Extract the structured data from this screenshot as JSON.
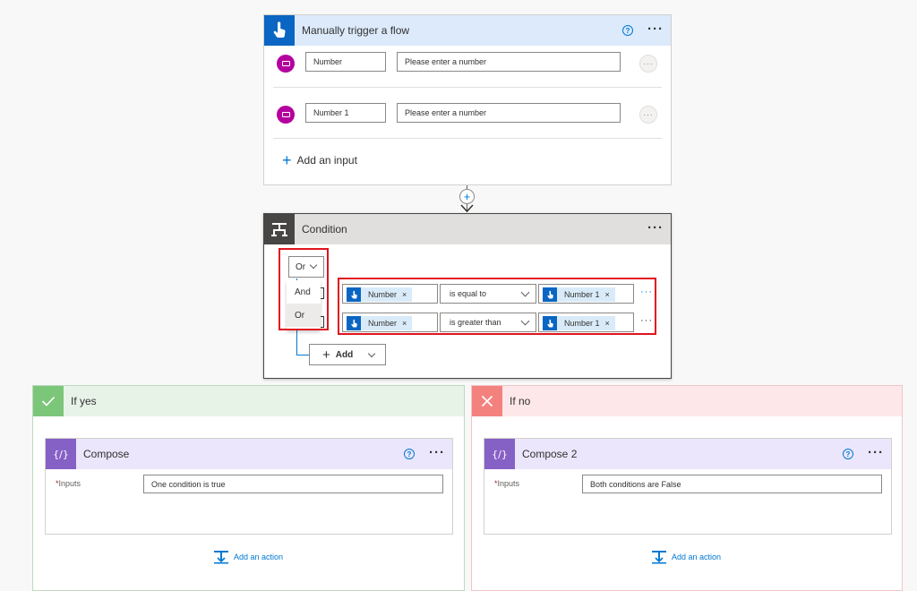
{
  "trigger": {
    "title": "Manually trigger a flow",
    "inputs": [
      {
        "name": "Number",
        "placeholder": "Please enter a number"
      },
      {
        "name": "Number 1",
        "placeholder": "Please enter a number"
      }
    ],
    "add_input_label": "Add an input",
    "plus_symbol": "+"
  },
  "condition": {
    "title": "Condition",
    "group_operator": "Or",
    "operator_options": [
      "And",
      "Or"
    ],
    "rows": [
      {
        "left": "Number",
        "operator": "is equal to",
        "right": "Number 1"
      },
      {
        "left": "Number",
        "operator": "is greater than",
        "right": "Number 1"
      }
    ],
    "add_label": "Add"
  },
  "branches": {
    "yes": {
      "title": "If yes",
      "action_title": "Compose",
      "input_label": "Inputs",
      "input_value": "One condition is true",
      "add_action_label": "Add an action"
    },
    "no": {
      "title": "If no",
      "action_title": "Compose 2",
      "input_label": "Inputs",
      "input_value": "Both conditions are False",
      "add_action_label": "Add an action"
    }
  },
  "colors": {
    "trigger_header": "#dceafc",
    "trigger_icon": "#0a66c2",
    "condition_header": "#e1dfdd",
    "condition_icon": "#484644",
    "yes_header": "#e8f3e8",
    "yes_icon": "#7cc67a",
    "no_header": "#fde7e9",
    "no_icon": "#f3827f",
    "compose_header": "#ebe6fb",
    "compose_icon": "#8661c5",
    "avatar": "#b4009e",
    "highlight": "#e0141e"
  }
}
